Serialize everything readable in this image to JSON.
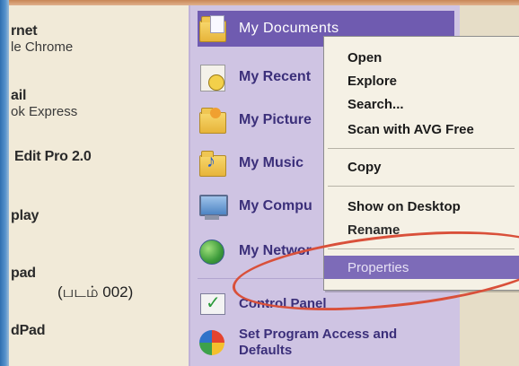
{
  "left_panel": {
    "items": [
      {
        "title": "rnet",
        "sub": "le Chrome"
      },
      {
        "title": "ail",
        "sub": "ok Express"
      },
      {
        "title": "Edit Pro 2.0",
        "sub": ""
      },
      {
        "title": "play",
        "sub": ""
      },
      {
        "title": "pad",
        "sub": ""
      },
      {
        "title": "dPad",
        "sub": ""
      }
    ],
    "caption": "(படம் 002)"
  },
  "right_panel": {
    "items": [
      {
        "label": "My Documents",
        "icon": "my-documents-icon"
      },
      {
        "label": "My Recent",
        "icon": "my-recent-documents-icon"
      },
      {
        "label": "My Picture",
        "icon": "my-pictures-icon"
      },
      {
        "label": "My Music",
        "icon": "my-music-icon"
      },
      {
        "label": "My Compu",
        "icon": "my-computer-icon"
      },
      {
        "label": "My Networ",
        "icon": "my-network-places-icon"
      },
      {
        "label": "Control Panel",
        "icon": "control-panel-icon"
      },
      {
        "label": "Set Program Access and Defaults",
        "icon": "set-program-access-icon"
      }
    ]
  },
  "context_menu": {
    "items": [
      {
        "label": "Open"
      },
      {
        "label": "Explore"
      },
      {
        "label": "Search..."
      },
      {
        "label": "Scan with AVG Free"
      },
      {
        "label": "Copy"
      },
      {
        "label": "Show on Desktop"
      },
      {
        "label": "Rename"
      },
      {
        "label": "Properties"
      }
    ]
  },
  "colors": {
    "panel_lavender": "#cfc4e3",
    "selection_purple": "#6f5bb0",
    "annotation_red": "#d9503a",
    "menu_background": "#f5f1e5"
  }
}
